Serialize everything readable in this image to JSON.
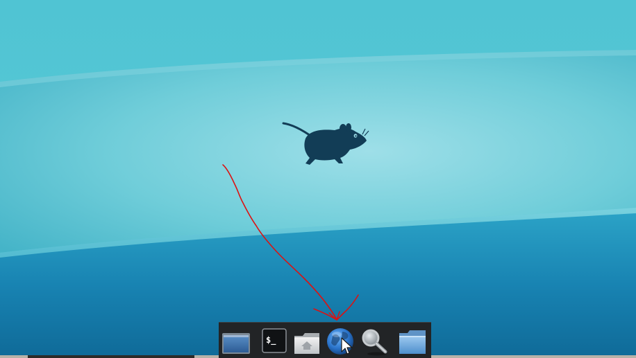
{
  "desktop": {
    "wallpaper": {
      "name": "xfce-mouse-wallpaper",
      "colors": {
        "sky_light": "#8fd8e3",
        "sky_mid": "#56c2d2",
        "sea_top": "#1e98c0",
        "sea_deep": "#106a97",
        "mouse": "#123d56"
      }
    },
    "annotation": {
      "name": "red-arrow-annotation",
      "color": "#dd1111"
    }
  },
  "dock": {
    "background": "#222426",
    "items": [
      {
        "name": "show-desktop",
        "icon": "window-icon"
      },
      {
        "name": "terminal",
        "icon": "terminal-icon",
        "label": "$_"
      },
      {
        "name": "home-folder",
        "icon": "home-folder-icon"
      },
      {
        "name": "web-browser",
        "icon": "globe-icon"
      },
      {
        "name": "app-finder",
        "icon": "magnifier-icon"
      },
      {
        "name": "file-manager",
        "icon": "folder-icon"
      }
    ]
  }
}
